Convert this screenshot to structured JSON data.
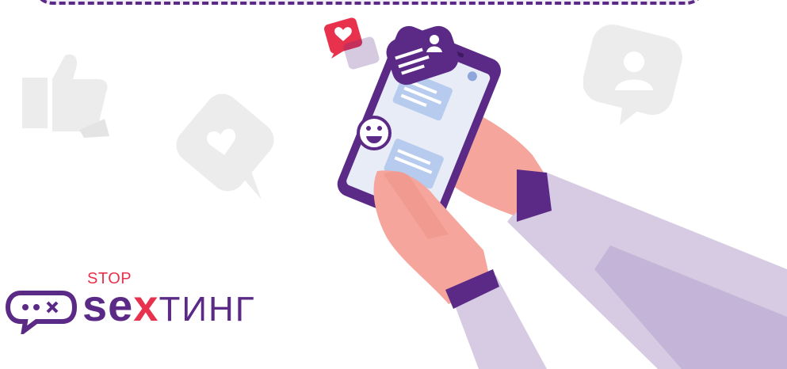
{
  "logo": {
    "stop_text": "STOP",
    "word_prefix": "se",
    "word_x": "x",
    "word_suffix": "ТИНГ"
  },
  "icons": {
    "thumbs_up": "thumbs-up-icon",
    "heart_bubble": "heart-bubble-icon",
    "user_bubble": "user-bubble-icon",
    "chat_bubble_logo": "chat-bubble-logo-icon"
  },
  "colors": {
    "brand_purple": "#5b2a86",
    "accent_red": "#e8314d",
    "skin": "#f5a59c",
    "sleeve": "#d6cbe2",
    "bg_icon_gray": "#ececec"
  }
}
